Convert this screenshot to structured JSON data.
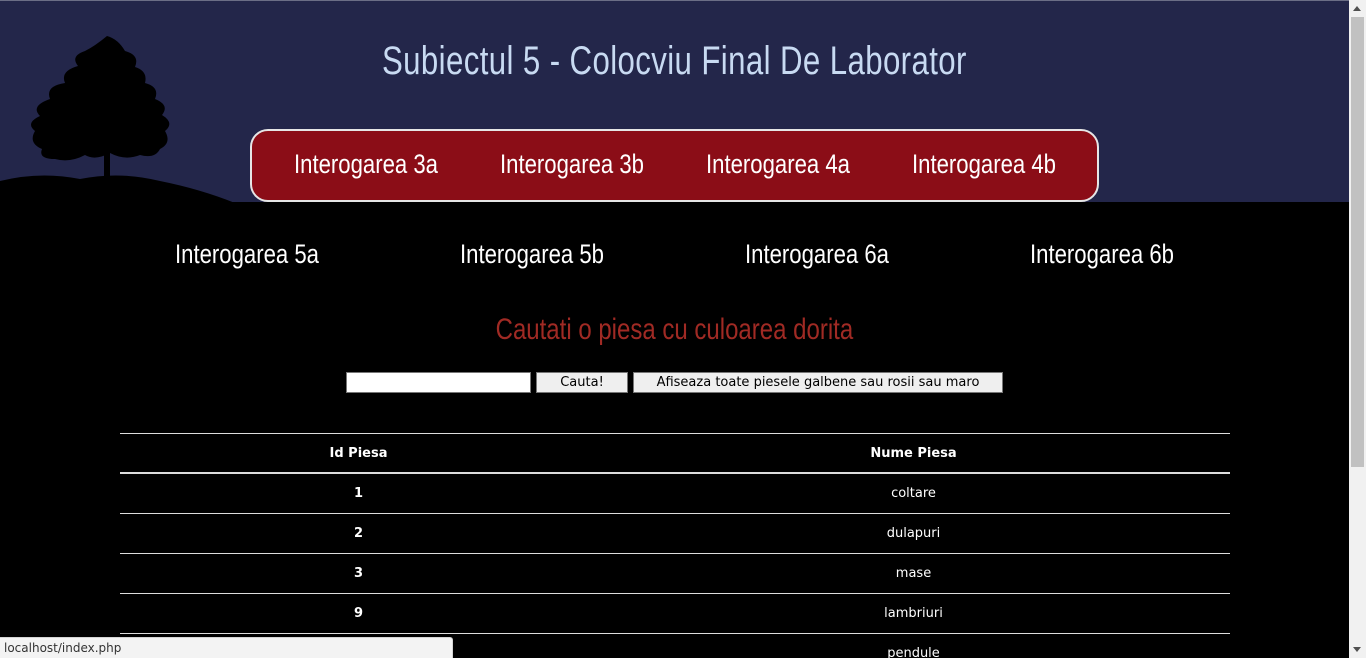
{
  "header": {
    "title": "Subiectul 5 - Colocviu Final De Laborator"
  },
  "nav_top": [
    "Interogarea 3a",
    "Interogarea 3b",
    "Interogarea 4a",
    "Interogarea 4b"
  ],
  "nav_bottom": [
    "Interogarea 5a",
    "Interogarea 5b",
    "Interogarea 6a",
    "Interogarea 6b"
  ],
  "search": {
    "heading": "Cautati o piesa cu culoarea dorita",
    "input_value": "",
    "search_button": "Cauta!",
    "show_all_button": "Afiseaza toate piesele galbene sau rosii sau maro"
  },
  "table": {
    "headers": [
      "Id Piesa",
      "Nume Piesa"
    ],
    "rows": [
      [
        "1",
        "coltare"
      ],
      [
        "2",
        "dulapuri"
      ],
      [
        "3",
        "mase"
      ],
      [
        "9",
        "lambriuri"
      ],
      [
        "",
        "pendule"
      ]
    ]
  },
  "statusbar": {
    "url": "localhost/index.php"
  },
  "colors": {
    "header_bg": "#23264a",
    "nav_bg": "#8b0d17",
    "title": "#c8daf2",
    "search_heading": "#a02a24",
    "page_bg": "#000000"
  }
}
